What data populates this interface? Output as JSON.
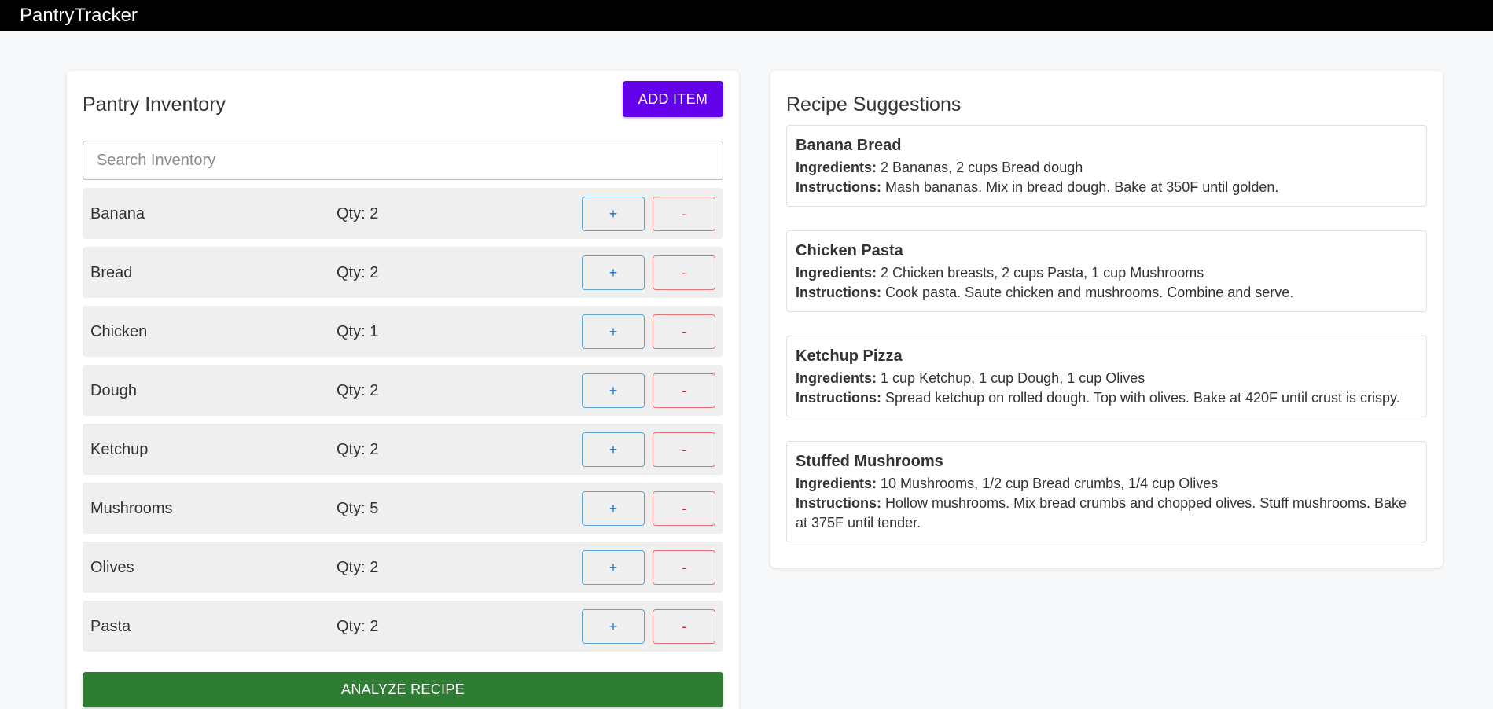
{
  "header": {
    "title": "PantryTracker"
  },
  "pantry": {
    "title": "Pantry Inventory",
    "add_label": "ADD ITEM",
    "search_placeholder": "Search Inventory",
    "plus_label": "+",
    "minus_label": "-",
    "items": [
      {
        "name": "Banana",
        "qty": "Qty: 2"
      },
      {
        "name": "Bread",
        "qty": "Qty: 2"
      },
      {
        "name": "Chicken",
        "qty": "Qty: 1"
      },
      {
        "name": "Dough",
        "qty": "Qty: 2"
      },
      {
        "name": "Ketchup",
        "qty": "Qty: 2"
      },
      {
        "name": "Mushrooms",
        "qty": "Qty: 5"
      },
      {
        "name": "Olives",
        "qty": "Qty: 2"
      },
      {
        "name": "Pasta",
        "qty": "Qty: 2"
      }
    ],
    "analyze_label": "ANALYZE RECIPE"
  },
  "recipes": {
    "title": "Recipe Suggestions",
    "ingredients_label": "Ingredients:",
    "instructions_label": "Instructions:",
    "items": [
      {
        "name": "Banana Bread",
        "ingredients": "2 Bananas, 2 cups Bread dough",
        "instructions": "Mash bananas. Mix in bread dough. Bake at 350F until golden."
      },
      {
        "name": "Chicken Pasta",
        "ingredients": "2 Chicken breasts, 2 cups Pasta, 1 cup Mushrooms",
        "instructions": "Cook pasta. Saute chicken and mushrooms. Combine and serve."
      },
      {
        "name": "Ketchup Pizza",
        "ingredients": "1 cup Ketchup, 1 cup Dough, 1 cup Olives",
        "instructions": "Spread ketchup on rolled dough. Top with olives. Bake at 420F until crust is crispy."
      },
      {
        "name": "Stuffed Mushrooms",
        "ingredients": "10 Mushrooms, 1/2 cup Bread crumbs, 1/4 cup Olives",
        "instructions": "Hollow mushrooms. Mix bread crumbs and chopped olives. Stuff mushrooms. Bake at 375F until tender."
      }
    ]
  },
  "colors": {
    "appbar": "#000000",
    "add_button": "#6200ea",
    "analyze_button": "#2e7d32",
    "plus_border": "#5aa6d6",
    "minus_border": "#e57373"
  }
}
